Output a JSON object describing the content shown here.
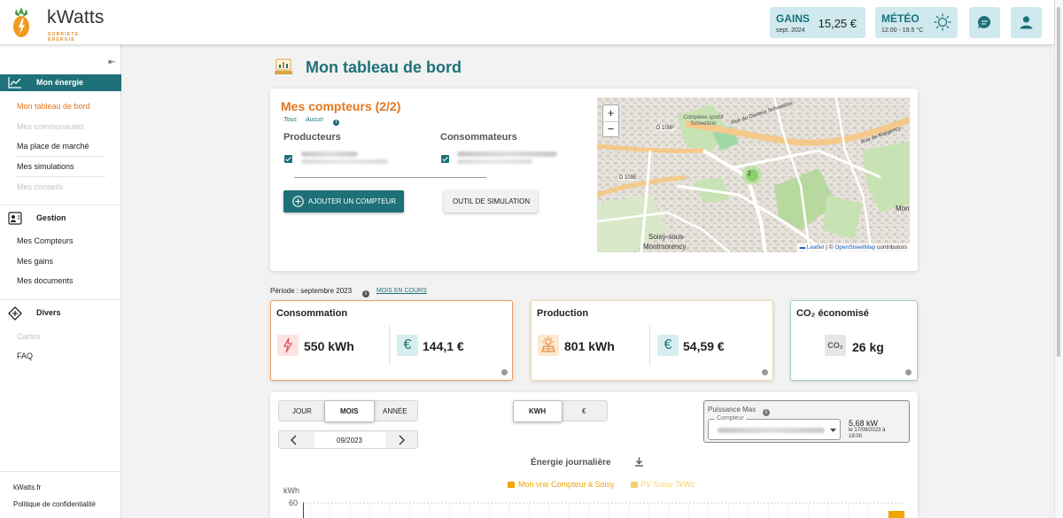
{
  "brand": {
    "name": "kWatts",
    "tagline": "SOBRIETE ENERGIE"
  },
  "header": {
    "gains": {
      "label": "GAINS",
      "period": "sept. 2024",
      "value": "15,25 €"
    },
    "meteo": {
      "label": "MÉTÉO",
      "detail": "12:00 - 19.5 °C"
    }
  },
  "sidebar": {
    "sections": [
      {
        "label": "Mon énergie",
        "icon": "chart-line-icon"
      },
      {
        "label": "Gestion",
        "icon": "user-settings-icon"
      },
      {
        "label": "Divers",
        "icon": "diamond-icon"
      }
    ],
    "energie_items": [
      "Mon tableau de bord",
      "Mes communautés",
      "Ma place de marché",
      "Mes simulations",
      "Mes conseils"
    ],
    "gestion_items": [
      "Mes Compteurs",
      "Mes gains",
      "Mes documents"
    ],
    "divers_items": [
      "Cartes",
      "FAQ"
    ],
    "footer": [
      "kWatts.fr",
      "Politique de confidentialité"
    ]
  },
  "page": {
    "title": "Mon tableau de bord"
  },
  "compteurs": {
    "title": "Mes compteurs (2/2)",
    "link_all": "Tous",
    "link_none": "Aucun",
    "producteurs_label": "Producteurs",
    "consommateurs_label": "Consommateurs",
    "add_button": "AJOUTER UN COMPTEUR",
    "sim_button": "OUTIL DE SIMULATION"
  },
  "map": {
    "zoom_in": "+",
    "zoom_out": "−",
    "cluster_count": "2",
    "attribution_leaflet": "Leaflet",
    "attribution_sep": " | © ",
    "attribution_osm": "OpenStreetMap",
    "attribution_rest": " contributors",
    "labels": {
      "rue_docteur": "Rue du Docteur Schweitzer",
      "rue_margency": "Rue de Margency",
      "d109p": "D 109P",
      "d109e": "D 109E",
      "complexe": "Complexe sportif Schweitzer",
      "soisy1": "Soisy-sous-",
      "soisy2": "Montmorency",
      "mont": "Mon"
    },
    "colors": {
      "park": "#c8e3b3",
      "road": "#f5c98a",
      "ground": "#e6e2dc"
    }
  },
  "periode": {
    "label": "Période : septembre 2023",
    "link": "MOIS EN COURS"
  },
  "kpis": {
    "consommation": {
      "title": "Consommation",
      "energy": "550 kWh",
      "cost": "144,1 €"
    },
    "production": {
      "title": "Production",
      "energy": "801 kWh",
      "cost": "54,59 €"
    },
    "co2": {
      "title": "CO₂ économisé",
      "badge": "CO₂",
      "value": "26 kg"
    }
  },
  "graph": {
    "period_tabs": [
      "JOUR",
      "MOIS",
      "ANNÉE"
    ],
    "selected_period": "MOIS",
    "unit_tabs": [
      "KWH",
      "€"
    ],
    "selected_unit": "KWH",
    "date_value": "09/2023",
    "puissance": {
      "label": "Puissance Max",
      "field_label": "Compteur",
      "value": "5,68 kW",
      "detail1": "le 17/09/2023 à",
      "detail2": "19:00"
    },
    "title": "Énergie journalière",
    "y_unit": "kWh",
    "y_tick": "60",
    "legend": [
      {
        "name": "Mon vrai Compteur à Soisy",
        "color": "#f0a500"
      },
      {
        "name": "PV Soisy 7kWc",
        "color": "#f6d36a"
      }
    ]
  },
  "colors": {
    "accent": "#1e7179",
    "orange": "#e2761f",
    "tile": "#cfe9ee"
  }
}
